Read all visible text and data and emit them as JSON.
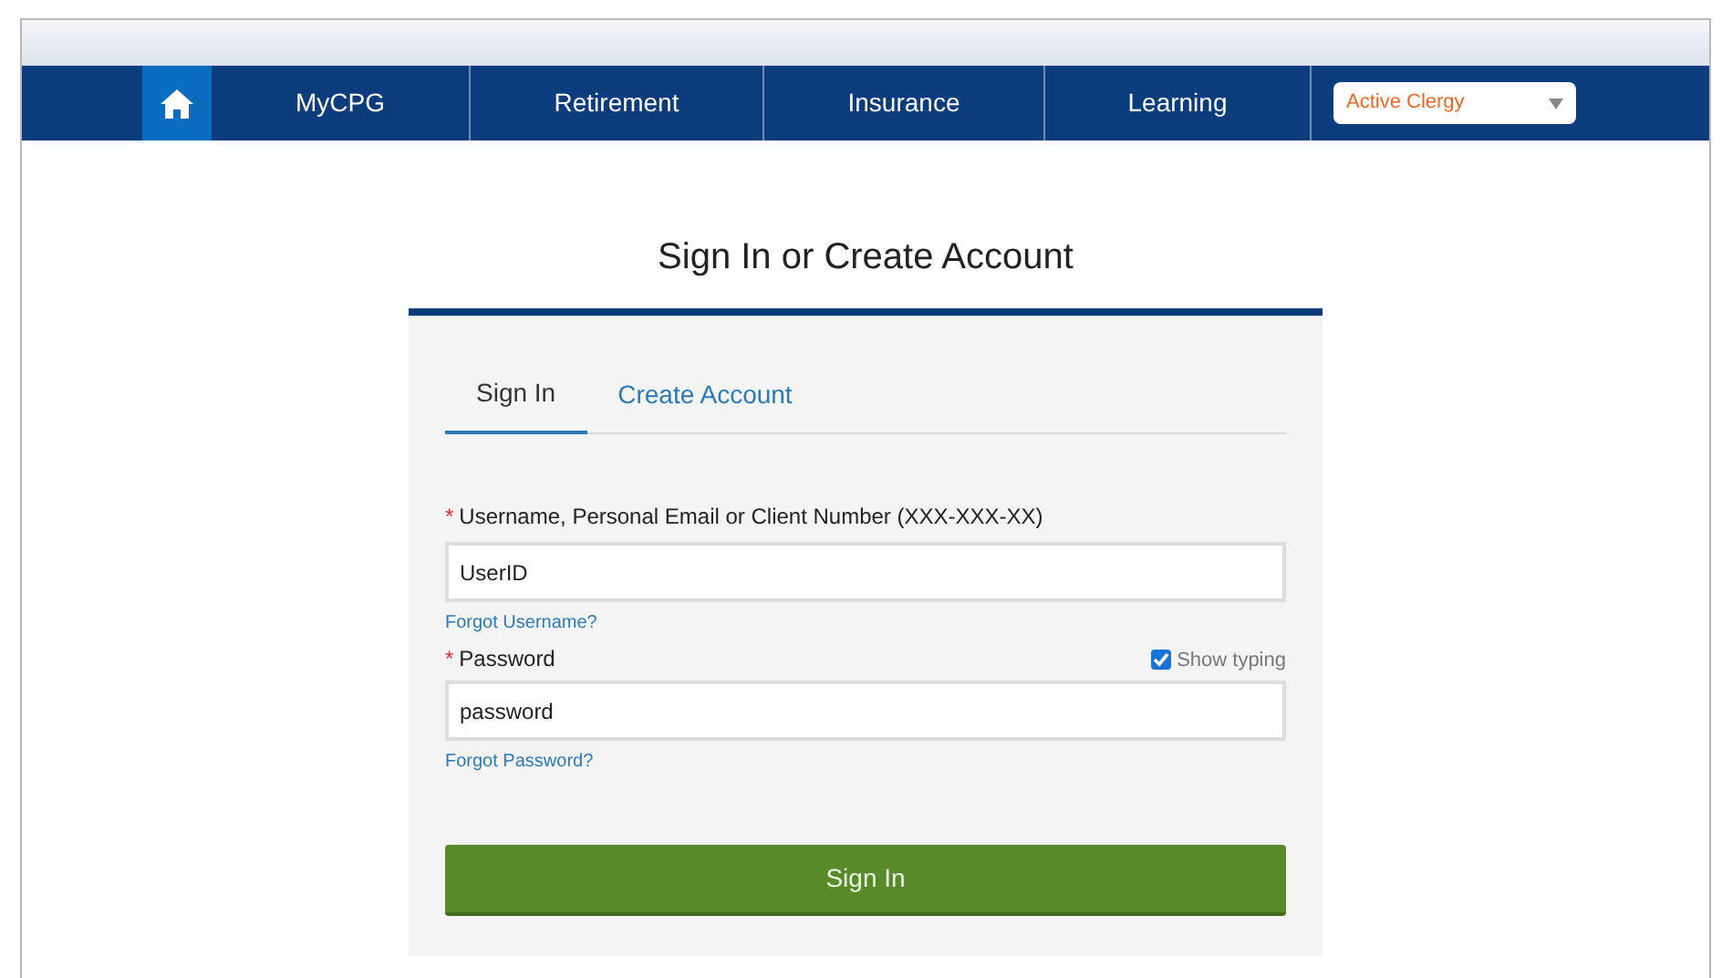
{
  "nav": {
    "items": [
      {
        "label": "MyCPG"
      },
      {
        "label": "Retirement"
      },
      {
        "label": "Insurance"
      },
      {
        "label": "Learning"
      }
    ],
    "audience_select": {
      "value": "Active Clergy"
    }
  },
  "heading": "Sign In or Create Account",
  "tabs": [
    {
      "label": "Sign In",
      "selected": true
    },
    {
      "label": "Create Account",
      "selected": false
    }
  ],
  "form": {
    "username": {
      "label": "Username, Personal Email or Client Number (XXX-XXX-XX)",
      "required_mark": "*",
      "value": "UserID",
      "link": "Forgot Username?"
    },
    "password": {
      "label": "Password",
      "required_mark": "*",
      "value": "password",
      "link": "Forgot Password?",
      "show_typing": {
        "label": "Show typing",
        "checked": true
      }
    },
    "submit": "Sign In"
  }
}
